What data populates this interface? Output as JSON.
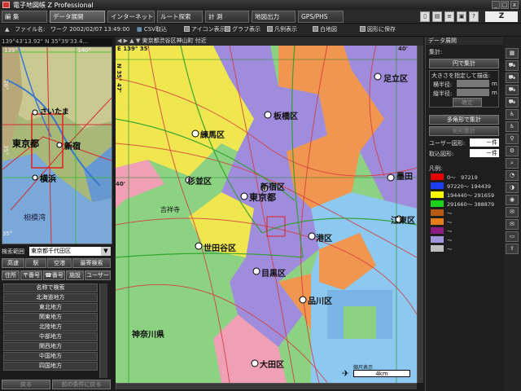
{
  "title": "電子地図帳 Z Professional",
  "window_controls": [
    "_",
    "□",
    "x"
  ],
  "tabs": [
    "編 集",
    "データ展開",
    "インターネット",
    "ルート探索",
    "計 測",
    "地図出力",
    "GPS/PHS"
  ],
  "toolbar": {
    "filename_label": "ファイル名:",
    "filename_value": "ワーク 2002/02/07 13:49:00",
    "csv_import": "CSV取込",
    "icon_display": "アイコン表示",
    "graph_display": "グラフ表示",
    "manual_display": "凡例表示",
    "white_map": "白地図",
    "save_figure": "図形に保存"
  },
  "mini": {
    "coord": "139°43'13.92\"  N 35°39'33.4...",
    "lon_left": "139°",
    "lon_right": "140°",
    "lat_top": "36°",
    "lat_mid": "35°",
    "lat_bot": "35°",
    "labels": {
      "saitama": "さいたま",
      "tokyo": "東京都",
      "shinjuku": "新宿",
      "yokohama": "横浜",
      "sagami": "相模湾"
    }
  },
  "search": {
    "range_label": "検索範囲",
    "range_value": "東京都千代田区",
    "buttons_row1": [
      "高速",
      "駅",
      "空港",
      "最寄検索"
    ],
    "tabs_row2": [
      "住所",
      "〒番号",
      "☎番号",
      "施設",
      "ユーザー"
    ],
    "list": [
      "名称で検索",
      "北海道地方",
      "東北地方",
      "関東地方",
      "北陸地方",
      "中部地方",
      "関西地方",
      "中国地方",
      "四国地方"
    ],
    "bottom_buttons": [
      "戻る",
      "前の条件に戻る"
    ]
  },
  "map": {
    "header": "東京都渋谷区神山町 付近",
    "lon_left": "E 139° 35'",
    "lon_right": "40'",
    "lat_top": "N 35° 47'",
    "lat_mid": "40'",
    "labels": {
      "adachi": "足立区",
      "itabashi": "板橋区",
      "nerima": "練馬区",
      "suginami": "杉並区",
      "shinjuku": "新宿区",
      "tokyo": "東京都",
      "kichijoji": "吉祥寺",
      "setagaya": "世田谷区",
      "meguro": "目黒区",
      "minato": "港区",
      "koto": "江東区",
      "shinagawa": "品川区",
      "kanagawa": "神奈川県",
      "ota": "大田区",
      "sumida": "墨田"
    },
    "scale_label": "4km",
    "scale_caption": "縮尺表示"
  },
  "right": {
    "panel_title": "データ展開",
    "aggregate_label": "集計:",
    "circle_agg": "円で集計",
    "size_hint": "大きさを指定して描画:",
    "width_label": "横半径:",
    "height_label": "縦半径:",
    "unit_m": "m",
    "ok_btn": "確定",
    "polygon_agg": "多角形で集計",
    "rect_agg": "矩形集計",
    "user_fig_label": "ユーザー図形:",
    "user_fig_val": "－件",
    "import_fig_label": "取込図形:",
    "import_fig_val": "－件",
    "legend_title": "凡例:",
    "legend": [
      {
        "color": "#e60000",
        "range": "0〜　97219"
      },
      {
        "color": "#1f3cf0",
        "range": "97220〜 194439"
      },
      {
        "color": "#f5f500",
        "range": "194440〜 291659"
      },
      {
        "color": "#19d219",
        "range": "291660〜 388879"
      },
      {
        "color": "#b45a14",
        "range": "〜"
      },
      {
        "color": "#e67d19",
        "range": "〜"
      },
      {
        "color": "#8c1e82",
        "range": "〜"
      },
      {
        "color": "#a096dc",
        "range": "〜"
      },
      {
        "color": "#bebebe",
        "range": "〜"
      }
    ]
  },
  "colors": {
    "accent": "#3c64c8",
    "district_purple": "#a08cdc",
    "district_yellow": "#f0e650",
    "district_orange": "#f09650",
    "district_green": "#8cd282",
    "district_pink": "#f0a0b4",
    "water": "#8cc8f0"
  }
}
